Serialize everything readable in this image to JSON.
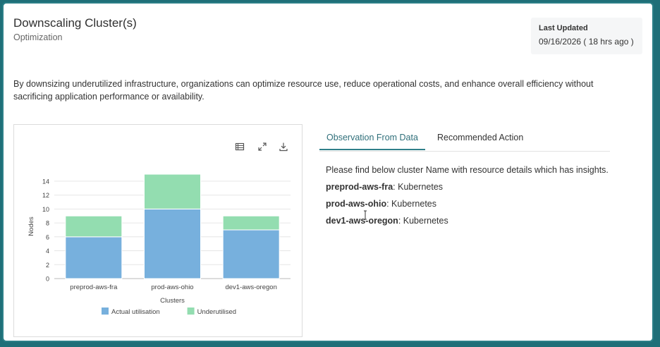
{
  "header": {
    "title": "Downscaling Cluster(s)",
    "subtitle": "Optimization",
    "last_updated_label": "Last Updated",
    "last_updated_value": "09/16/2026 ( 18 hrs ago )"
  },
  "description": "By downsizing underutilized infrastructure, organizations can optimize resource use, reduce operational costs, and enhance overall efficiency without sacrificing application performance or availability.",
  "chart_toolbar": [
    "table-view-icon",
    "expand-icon",
    "download-icon"
  ],
  "chart_data": {
    "type": "bar",
    "stacked": true,
    "categories": [
      "preprod-aws-fra",
      "prod-aws-ohio",
      "dev1-aws-oregon"
    ],
    "series": [
      {
        "name": "Actual utilisation",
        "values": [
          6,
          10,
          7
        ],
        "color": "#77b0dd"
      },
      {
        "name": "Underutilised",
        "values": [
          3,
          5,
          2
        ],
        "color": "#93ddb0"
      }
    ],
    "xlabel": "Clusters",
    "ylabel": "Nodes",
    "ylim": [
      0,
      15
    ],
    "yticks": [
      0,
      2,
      4,
      6,
      8,
      10,
      12,
      14
    ],
    "grid": true,
    "legend_position": "bottom"
  },
  "tabs": [
    {
      "label": "Observation From Data",
      "active": true
    },
    {
      "label": "Recommended Action",
      "active": false
    }
  ],
  "observation": {
    "intro": "Please find below cluster Name with resource details which has insights.",
    "items": [
      {
        "name": "preprod-aws-fra",
        "detail": ": Kubernetes"
      },
      {
        "name": "prod-aws-ohio",
        "detail": ": Kubernetes"
      },
      {
        "name": "dev1-aws-oregon",
        "detail": ": Kubernetes"
      }
    ]
  },
  "colors": {
    "frame": "#2b7f87",
    "accent": "#2f7f89",
    "actual": "#77b0dd",
    "underutilised": "#93ddb0"
  }
}
